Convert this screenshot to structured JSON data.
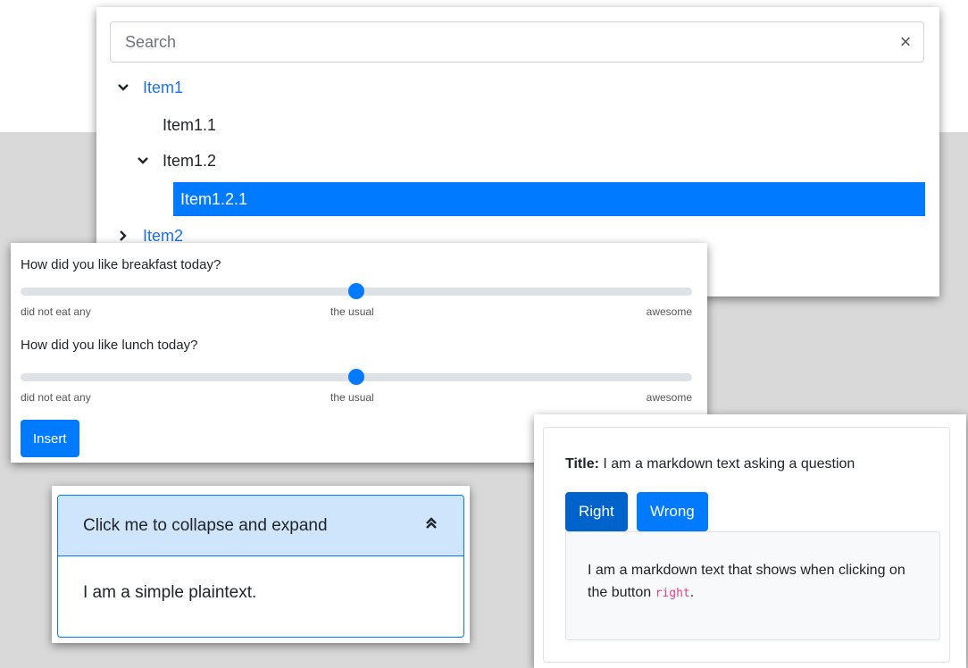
{
  "tree": {
    "search_placeholder": "Search",
    "clear_icon": "×",
    "items": [
      {
        "label": "Item1",
        "expanded": true,
        "color": "#1a73e8"
      },
      {
        "label": "Item1.1"
      },
      {
        "label": "Item1.2",
        "expanded": true
      },
      {
        "label": "Item1.2.1",
        "selected": true,
        "color": "#007bff"
      },
      {
        "label": "Item2",
        "expanded": false,
        "color": "#1a73e8"
      }
    ]
  },
  "sliders": {
    "items": [
      {
        "question": "How did you like breakfast today?",
        "value": 0.5,
        "ticks": [
          "did not eat any",
          "the usual",
          "awesome"
        ]
      },
      {
        "question": "How did you like lunch today?",
        "value": 0.5,
        "ticks": [
          "did not eat any",
          "the usual",
          "awesome"
        ]
      }
    ],
    "insert_label": "Insert",
    "accent": "#007bff"
  },
  "collapse": {
    "header": "Click me to collapse and expand",
    "body": "I am a simple plaintext.",
    "icon": "chevrons-up-icon"
  },
  "question": {
    "title_label": "Title:",
    "title_text": "I am a markdown text asking a question",
    "right_label": "Right",
    "wrong_label": "Wrong",
    "answer_text": "I am a markdown text that shows when clicking on the button",
    "answer_code": "right",
    "answer_end": "."
  }
}
